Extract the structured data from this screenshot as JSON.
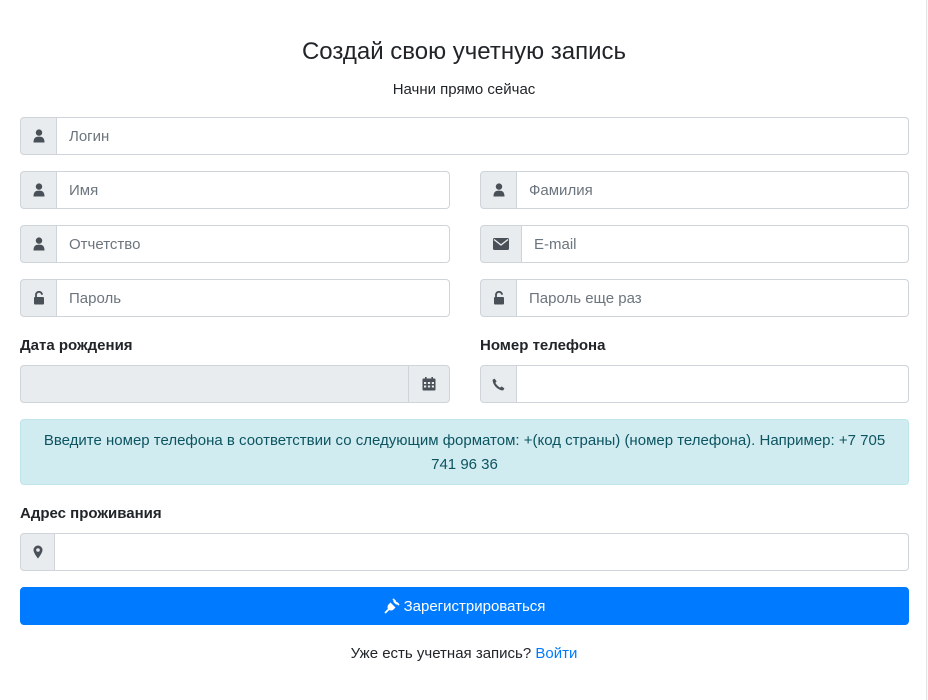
{
  "header": {
    "title": "Создай свою учетную запись",
    "subtitle": "Начни прямо сейчас"
  },
  "form": {
    "login": {
      "placeholder": "Логин",
      "icon": "user-icon"
    },
    "first_name": {
      "placeholder": "Имя",
      "icon": "user-icon"
    },
    "last_name": {
      "placeholder": "Фамилия",
      "icon": "user-icon"
    },
    "middle_name": {
      "placeholder": "Отчетство",
      "icon": "user-icon"
    },
    "email": {
      "placeholder": "E-mail",
      "icon": "envelope-icon"
    },
    "password": {
      "placeholder": "Пароль",
      "icon": "unlock-icon"
    },
    "password_repeat": {
      "placeholder": "Пароль еще раз",
      "icon": "unlock-icon"
    },
    "birth_date": {
      "label": "Дата рождения",
      "value": "",
      "icon": "calendar-icon"
    },
    "phone": {
      "label": "Номер телефона",
      "value": "",
      "icon": "phone-icon"
    },
    "phone_hint": "Введите номер телефона в соответствии со следующим форматом: +(код страны) (номер телефона). Например: +7 705 741 96 36",
    "address": {
      "label": "Адрес проживания",
      "value": "",
      "icon": "map-marker-icon"
    },
    "submit_label": "Зарегистрироваться",
    "submit_icon": "plug-icon"
  },
  "footer": {
    "text": "Уже есть учетная запись?",
    "login_link": "Войти"
  },
  "colors": {
    "primary": "#007bff",
    "alert_bg": "#d1ecf1",
    "alert_text": "#0c5460",
    "addon_bg": "#e9ecef",
    "icon": "#495057"
  }
}
